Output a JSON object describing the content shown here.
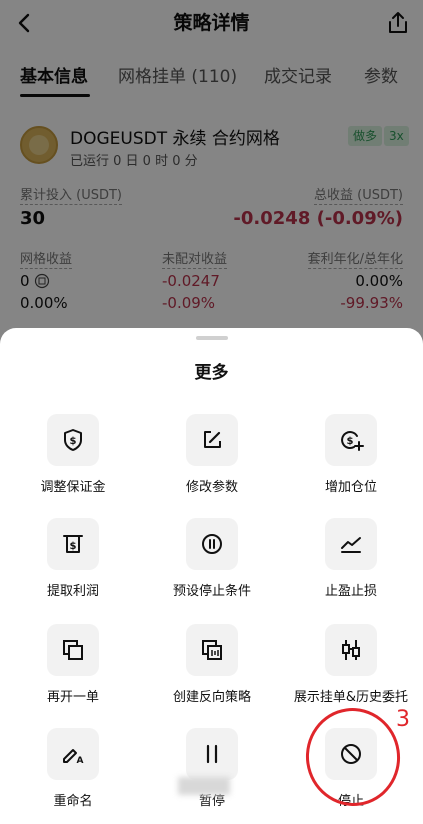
{
  "nav": {
    "title": "策略详情"
  },
  "tabs": [
    "基本信息",
    "网格挂单 (110)",
    "成交记录",
    "参数"
  ],
  "strategy": {
    "name": "DOGEUSDT 永续 合约网格",
    "badges": [
      "做多",
      "3x"
    ],
    "runtime": "已运行 0 日 0 时 0 分"
  },
  "stats": {
    "invest_label": "累计投入 (USDT)",
    "invest_value": "30",
    "profit_label": "总收益 (USDT)",
    "profit_value": "-0.0248 (-0.09%)",
    "grid_label": "网格收益",
    "grid_value": "0",
    "grid_pct": "0.00%",
    "unmatched_label": "未配对收益",
    "unmatched_value": "-0.0247",
    "unmatched_pct": "-0.09%",
    "annual_label": "套利年化/总年化",
    "annual_value": "0.00%",
    "annual_total": "-99.93%"
  },
  "sheet": {
    "title": "更多",
    "actions": [
      {
        "label": "调整保证金",
        "icon": "shield-dollar-icon"
      },
      {
        "label": "修改参数",
        "icon": "edit-icon"
      },
      {
        "label": "增加仓位",
        "icon": "coin-plus-icon"
      },
      {
        "label": "提取利润",
        "icon": "withdraw-icon"
      },
      {
        "label": "预设停止条件",
        "icon": "pause-circle-icon"
      },
      {
        "label": "止盈止损",
        "icon": "trend-line-icon"
      },
      {
        "label": "再开一单",
        "icon": "duplicate-icon"
      },
      {
        "label": "创建反向策略",
        "icon": "reverse-icon"
      },
      {
        "label": "展示挂单&历史委托",
        "icon": "candlestick-icon"
      },
      {
        "label": "重命名",
        "icon": "rename-icon"
      },
      {
        "label": "暂停",
        "icon": "pause-icon"
      },
      {
        "label": "停止",
        "icon": "stop-icon"
      }
    ]
  },
  "annotation": {
    "number": "3",
    "color": "#e0262b"
  },
  "colors": {
    "negative": "#b8324b",
    "badge_bg": "#d9f1df",
    "badge_text": "#2f9a57"
  }
}
